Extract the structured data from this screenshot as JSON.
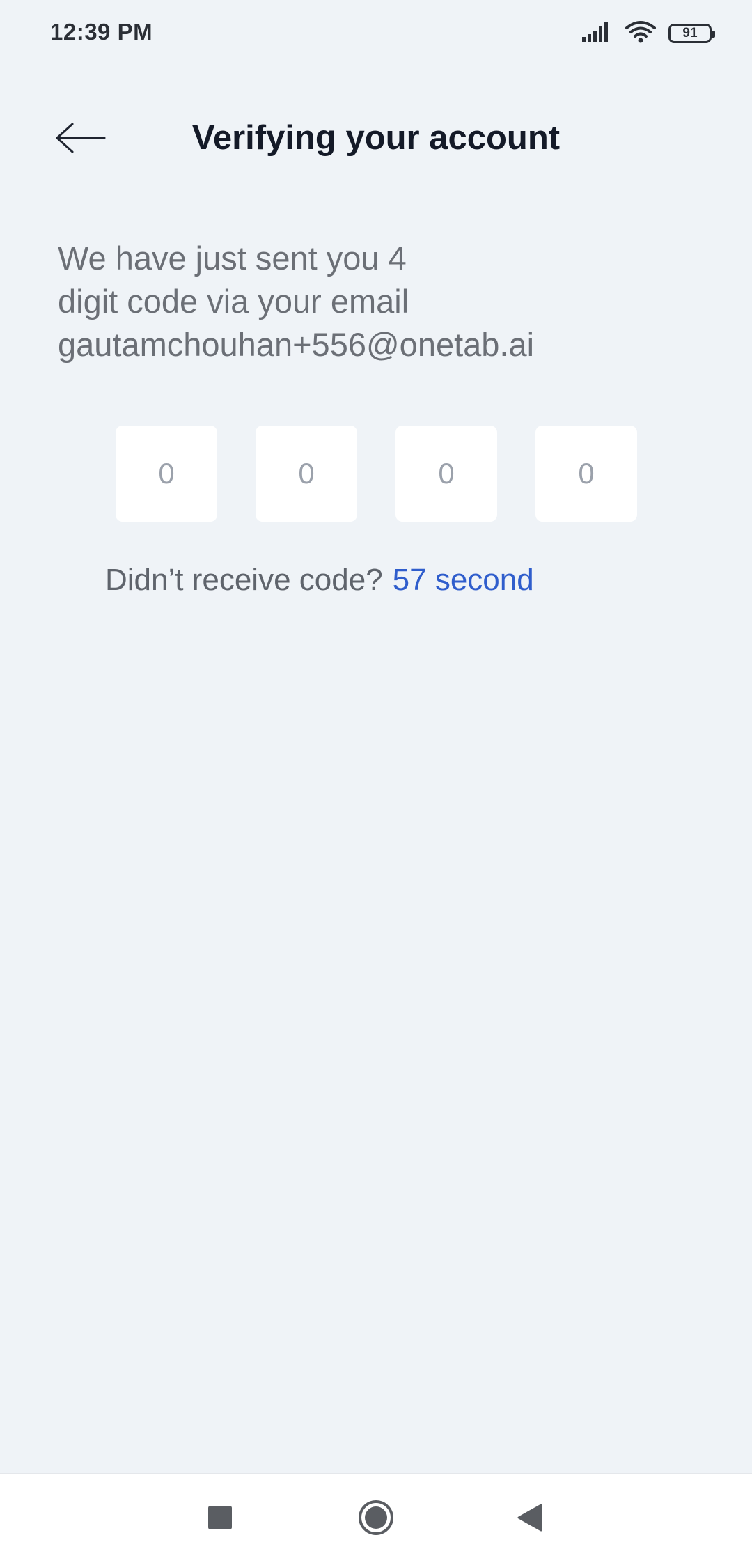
{
  "status_bar": {
    "time": "12:39 PM",
    "battery_level": "91",
    "icons": [
      "signal-icon",
      "wifi-icon",
      "battery-icon"
    ]
  },
  "header": {
    "back_icon": "arrow-left-icon",
    "title": "Verifying your account"
  },
  "description": {
    "line1": "We have just sent you 4",
    "line2": "digit code via your email",
    "email": "gautamchouhan+556@onetab.ai"
  },
  "code_inputs": [
    {
      "placeholder": "0",
      "value": ""
    },
    {
      "placeholder": "0",
      "value": ""
    },
    {
      "placeholder": "0",
      "value": ""
    },
    {
      "placeholder": "0",
      "value": ""
    }
  ],
  "resend": {
    "label": "Didn’t receive code?",
    "timer": "57 second"
  },
  "nav_bar": {
    "icons": [
      "recents-square-icon",
      "home-circle-icon",
      "back-triangle-icon"
    ]
  },
  "colors": {
    "background": "#eff3f7",
    "accent": "#2f5dcc",
    "title": "#141a28",
    "muted_text": "#6b6f76"
  }
}
